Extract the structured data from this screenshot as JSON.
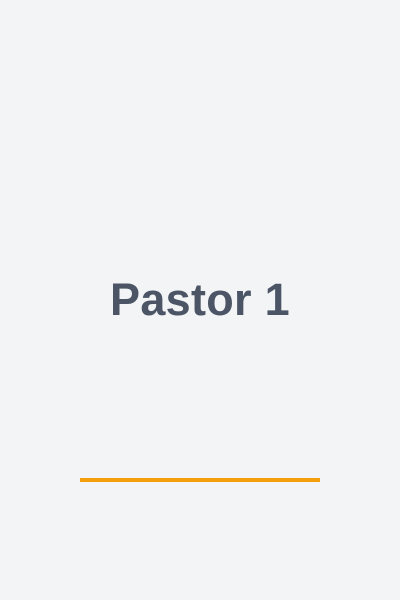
{
  "card": {
    "title": "Pastor 1"
  },
  "colors": {
    "background": "#f3f4f6",
    "title_text": "#4b5565",
    "accent": "#f59e0b"
  }
}
